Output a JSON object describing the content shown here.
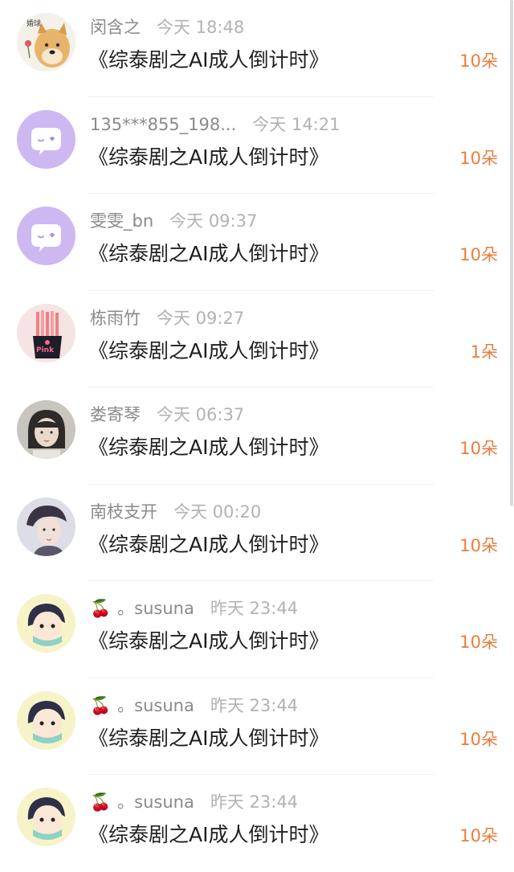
{
  "gifts": [
    {
      "name": "闵含之",
      "time": "今天 18:48",
      "title": "《综泰剧之AI成人倒计时》",
      "count": "10朵",
      "avatar": "dog"
    },
    {
      "name": "135***855_198...",
      "time": "今天 14:21",
      "title": "《综泰剧之AI成人倒计时》",
      "count": "10朵",
      "avatar": "chat-bubble"
    },
    {
      "name": "雯雯_bn",
      "time": "今天 09:37",
      "title": "《综泰剧之AI成人倒计时》",
      "count": "10朵",
      "avatar": "chat-bubble"
    },
    {
      "name": "栋雨竹",
      "time": "今天 09:27",
      "title": "《综泰剧之AI成人倒计时》",
      "count": "1朵",
      "avatar": "pink-fries"
    },
    {
      "name": "娄寄琴",
      "time": "今天 06:37",
      "title": "《综泰剧之AI成人倒计时》",
      "count": "10朵",
      "avatar": "girl-photo"
    },
    {
      "name": "南枝支开",
      "time": "今天 00:20",
      "title": "《综泰剧之AI成人倒计时》",
      "count": "10朵",
      "avatar": "boy-photo"
    },
    {
      "name": "。susuna",
      "emoji": "🍒",
      "time": "昨天 23:44",
      "title": "《综泰剧之AI成人倒计时》",
      "count": "10朵",
      "avatar": "cartoon-boy"
    },
    {
      "name": "。susuna",
      "emoji": "🍒",
      "time": "昨天 23:44",
      "title": "《综泰剧之AI成人倒计时》",
      "count": "10朵",
      "avatar": "cartoon-boy"
    },
    {
      "name": "。susuna",
      "emoji": "🍒",
      "time": "昨天 23:44",
      "title": "《综泰剧之AI成人倒计时》",
      "count": "10朵",
      "avatar": "cartoon-boy"
    }
  ],
  "avatar_text": {
    "dog": "婚球",
    "pink-fries": "Pink"
  },
  "colors": {
    "accent": "#e87d3e",
    "bubble": "#cdb8f2"
  }
}
